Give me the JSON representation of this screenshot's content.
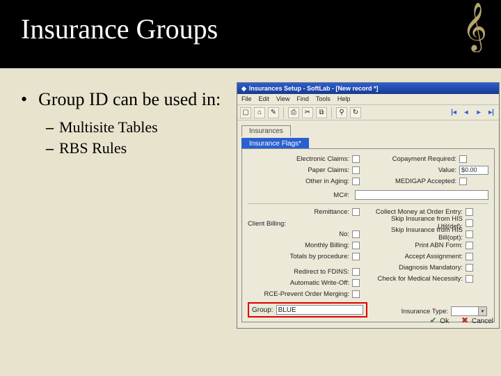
{
  "slide": {
    "title": "Insurance Groups",
    "bullet": "Group ID can be used in:",
    "sub1": "Multisite Tables",
    "sub2": "RBS Rules"
  },
  "app": {
    "window_title": "Insurances Setup - SoftLab - [New record *]",
    "menu": {
      "file": "File",
      "edit": "Edit",
      "view": "View",
      "find": "Find",
      "tools": "Tools",
      "help": "Help"
    },
    "tabs": {
      "insurances": "Insurances",
      "flags": "Insurance Flags*"
    },
    "panel": {
      "electronic_claims": "Electronic Claims:",
      "paper_claims": "Paper Claims:",
      "other_in_aging": "Other in Aging:",
      "copayment_required": "Copayment Required:",
      "value_label": "Value:",
      "value_text": "$0.00",
      "medigap_accepted": "MEDIGAP Accepted:",
      "mc_label": "MC#:",
      "remittance": "Remittance:",
      "collect_money": "Collect Money at Order Entry:",
      "skip_ins_util_def": "Skip Insurance from HIS Util(def):",
      "skip_ins_bill_opt": "Skip Insurance from HIS Bill(opt):",
      "print_abn": "Print ABN Form:",
      "accept_assignment": "Accept Assignment:",
      "diagnosis_mandatory": "Diagnosis Mandatory:",
      "check_mn": "Check for Medical Necessity:",
      "insurance_type": "Insurance Type:",
      "client_billing": "Client Billing:",
      "cb_no": "No:",
      "cb_monthly": "Monthly Billing:",
      "cb_totals": "Totals by procedure:",
      "redirect_fdins": "Redirect to FDINS:",
      "auto_write_off": "Automatic Write-Off:",
      "rce_prevent": "RCE-Prevent Order Merging:",
      "group_label": "Group:",
      "group_value": "BLUE"
    },
    "buttons": {
      "ok": "Ok",
      "cancel": "Cancel"
    }
  }
}
